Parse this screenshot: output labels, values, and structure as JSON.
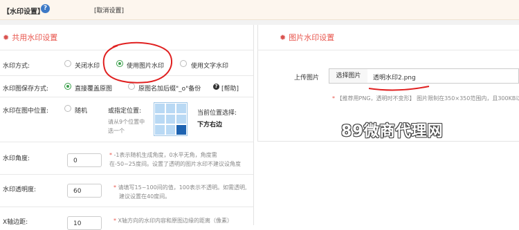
{
  "header": {
    "title": "【水印设置】",
    "help_glyph": "?",
    "cancel_link": "[取消设置]"
  },
  "shared": {
    "section_title": "共用水印设置",
    "watermark_mode": {
      "label": "水印方式:",
      "options": [
        "关闭水印",
        "使用图片水印",
        "使用文字水印"
      ],
      "selected": "使用图片水印"
    },
    "save_mode": {
      "label": "水印图保存方式:",
      "options": [
        "直接覆盖原图",
        "原图名加后缀\"_o\"备份"
      ],
      "selected": "直接覆盖原图",
      "help_link": "[帮助]"
    },
    "position": {
      "label": "水印在图中位置:",
      "random_option": "随机",
      "or_specify": "或指定位置:",
      "hint_line1": "请从9个位置中",
      "hint_line2": "选一个",
      "current_label": "当前位置选择:",
      "current_value": "下方右边",
      "selected_cell_index": 8
    },
    "angle": {
      "label": "水印角度:",
      "value": "0",
      "hint_line1": "-1表示随机生成角度，0水平无角，角度需",
      "hint_line2": "在-50~25度间。设置了透明的图片水印不建议设角度"
    },
    "opacity": {
      "label": "水印透明度:",
      "value": "60",
      "hint_line1": "请填写15~100间的值，100表示不透明。如需透明,",
      "hint_line2": "建议设置在40度间。"
    },
    "x_margin": {
      "label": "X轴边距:",
      "value": "10",
      "hint_line1": "X轴方向的水印内容和原图边缘的距离（像素）"
    }
  },
  "image": {
    "section_title": "图片水印设置",
    "upload_label": "上传图片",
    "choose_button": "选择图片",
    "file_name": "透明水印2.png",
    "hint": "【推荐用PNG，透明时不变形】 图片限制在350×350范围内，且300KB以"
  },
  "overlay_text": "89微商代理网",
  "colors": {
    "accent_red": "#e8564d",
    "radio_green": "#3a9f4a",
    "grid_selected": "#1e63b1",
    "annotation_red": "#e02020"
  }
}
